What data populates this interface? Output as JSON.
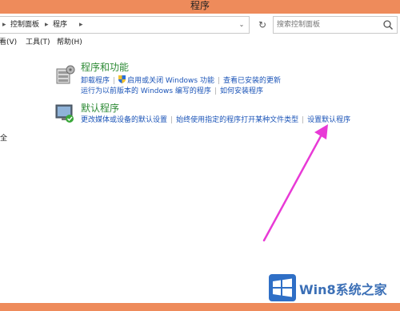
{
  "window": {
    "title": "程序"
  },
  "address": {
    "crumbs": [
      "控制面板",
      "程序"
    ],
    "search_placeholder": "搜索控制面板"
  },
  "menu": {
    "items": [
      "看(V)",
      "工具(T)",
      "帮助(H)"
    ]
  },
  "left_truncated": "全",
  "sections": [
    {
      "title": "程序和功能",
      "icon": "programs-features-icon",
      "links_row1": [
        "卸载程序",
        "启用或关闭 Windows 功能",
        "查看已安装的更新"
      ],
      "links_row2": [
        "运行为以前版本的 Windows 编写的程序",
        "如何安装程序"
      ]
    },
    {
      "title": "默认程序",
      "icon": "default-programs-icon",
      "links_row1": [
        "更改媒体或设备的默认设置",
        "始终使用指定的程序打开某种文件类型",
        "设置默认程序"
      ]
    }
  ],
  "colors": {
    "titlebar": "#ee8b5b",
    "link": "#1c55b8",
    "section_title": "#2e8b36",
    "arrow": "#e83ad6"
  },
  "watermark": {
    "text": "Win8系统之家"
  }
}
